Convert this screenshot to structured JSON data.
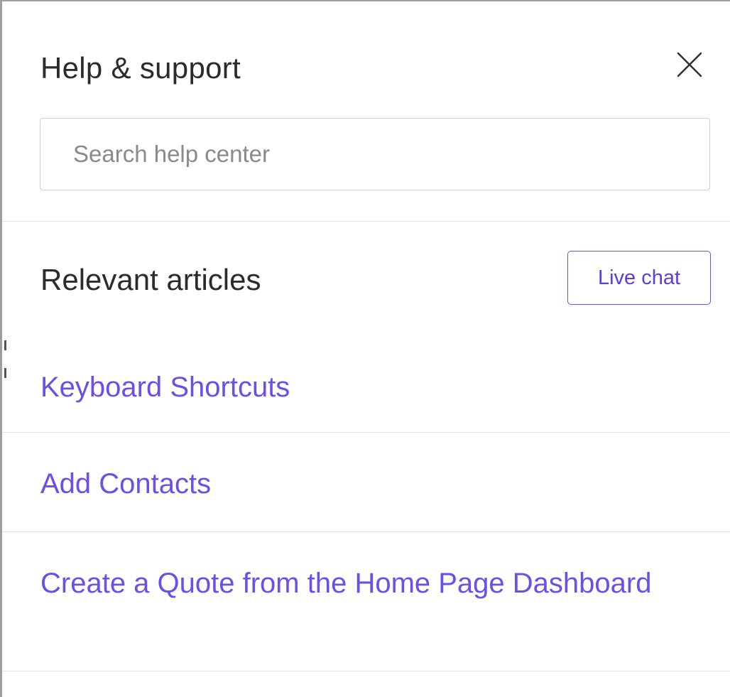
{
  "panel": {
    "title": "Help & support",
    "close_icon": "close-icon"
  },
  "search": {
    "placeholder": "Search help center",
    "value": ""
  },
  "articles_section": {
    "title": "Relevant articles",
    "live_chat_label": "Live chat"
  },
  "articles": [
    {
      "title": "Keyboard Shortcuts"
    },
    {
      "title": "Add Contacts"
    },
    {
      "title": "Create a Quote from the Home Page Dashboard"
    }
  ],
  "colors": {
    "link": "#6a4fe8",
    "button_border": "#6a4fe0",
    "text": "#2b2b2b",
    "divider": "#e2e2e2"
  }
}
